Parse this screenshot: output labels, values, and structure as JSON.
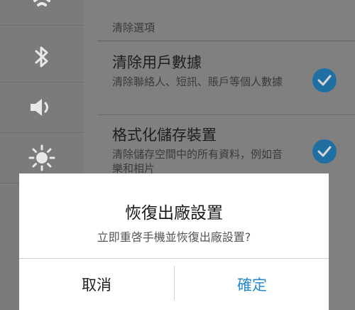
{
  "settings": {
    "section_header": "清除選項",
    "options": [
      {
        "title": "清除用戶數據",
        "description": "清除聯絡人、短訊、賬戶等個人數據",
        "checked": true
      },
      {
        "title": "格式化儲存裝置",
        "description": "清除儲存空間中的所有資料，例如音樂和相片",
        "checked": true
      }
    ]
  },
  "rail_icons": [
    "wifi-icon",
    "bluetooth-icon",
    "volume-icon",
    "brightness-icon"
  ],
  "dialog": {
    "title": "恢復出廠設置",
    "message": "立即重啓手機並恢復出廠設置?",
    "cancel_label": "取消",
    "confirm_label": "確定"
  },
  "colors": {
    "accent": "#2a8ad1",
    "check": "#1f6fa3",
    "dim_background": "#808080"
  }
}
